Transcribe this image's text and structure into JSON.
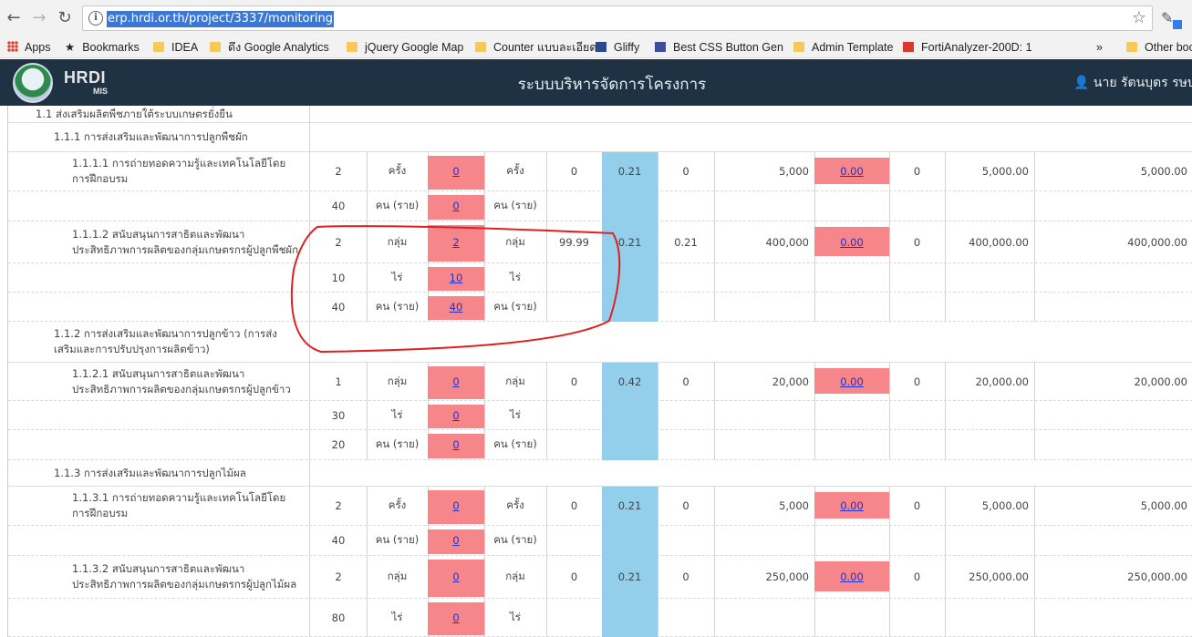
{
  "browser": {
    "url": "erp.hrdi.or.th/project/3337/monitoring",
    "bookmarks": [
      {
        "label": "Apps"
      },
      {
        "label": "Bookmarks"
      },
      {
        "label": "IDEA"
      },
      {
        "label": "ดึง Google Analytics"
      },
      {
        "label": "jQuery Google Map"
      },
      {
        "label": "Counter แบบละเอียด"
      },
      {
        "label": "Gliffy"
      },
      {
        "label": "Best CSS Button Gen"
      },
      {
        "label": "Admin Template"
      },
      {
        "label": "FortiAnalyzer-200D: 1"
      },
      {
        "label": "Other boo"
      }
    ],
    "more_label": "»"
  },
  "app": {
    "brand": "HRDI",
    "brand_sub": "MIS",
    "title": "ระบบบริหารจัดการโครงการ",
    "user": "นาย รัตนบุตร รษบุต"
  },
  "table": {
    "sections": [
      {
        "label": "1.1 ส่งเสริมผลิตพืชภายใต้ระบบเกษตรยั่งยืน"
      },
      {
        "label": "1.1.1 การส่งเสริมและพัฒนาการปลูกพืชผัก"
      },
      {
        "label": "1.1.2 การส่งเสริมและพัฒนาการปลูกข้าว (การส่งเสริมและการปรับปรุงการผลิตข้าว)"
      },
      {
        "label": "1.1.3 การส่งเสริมและพัฒนาการปลูกไม้ผล"
      }
    ],
    "rows": [
      {
        "label": "1.1.1.1 การถ่ายทอดความรู้และเทคโนโลยีโดยการฝึกอบรม",
        "target": "2",
        "unit": "ครั้ง",
        "actual": "0",
        "unit2": "ครั้ง",
        "pct": "0",
        "weight": "0.21",
        "score": "0",
        "budget": "5,000",
        "spent": "0.00",
        "spent_pct": "0",
        "alloc": "5,000.00",
        "total": "5,000.00"
      },
      {
        "label": "",
        "target": "40",
        "unit": "คน (ราย)",
        "actual": "0",
        "unit2": "คน (ราย)"
      },
      {
        "label": "1.1.1.2 สนับสนุนการสาธิตและพัฒนาประสิทธิภาพการผลิตของกลุ่มเกษตรกรผู้ปลูกพืชผัก",
        "target": "2",
        "unit": "กลุ่ม",
        "actual": "2",
        "unit2": "กลุ่ม",
        "pct": "99.99",
        "weight": "0.21",
        "score": "0.21",
        "budget": "400,000",
        "spent": "0.00",
        "spent_pct": "0",
        "alloc": "400,000.00",
        "total": "400,000.00"
      },
      {
        "label": "",
        "target": "10",
        "unit": "ไร่",
        "actual": "10",
        "unit2": "ไร่"
      },
      {
        "label": "",
        "target": "40",
        "unit": "คน (ราย)",
        "actual": "40",
        "unit2": "คน (ราย)"
      },
      {
        "label": "1.1.2.1 สนับสนุนการสาธิตและพัฒนาประสิทธิภาพการผลิตของกลุ่มเกษตรกรผู้ปลูกข้าว",
        "target": "1",
        "unit": "กลุ่ม",
        "actual": "0",
        "unit2": "กลุ่ม",
        "pct": "0",
        "weight": "0.42",
        "score": "0",
        "budget": "20,000",
        "spent": "0.00",
        "spent_pct": "0",
        "alloc": "20,000.00",
        "total": "20,000.00"
      },
      {
        "label": "",
        "target": "30",
        "unit": "ไร่",
        "actual": "0",
        "unit2": "ไร่"
      },
      {
        "label": "",
        "target": "20",
        "unit": "คน (ราย)",
        "actual": "0",
        "unit2": "คน (ราย)"
      },
      {
        "label": "1.1.3.1 การถ่ายทอดความรู้และเทคโนโลยีโดยการฝึกอบรม",
        "target": "2",
        "unit": "ครั้ง",
        "actual": "0",
        "unit2": "ครั้ง",
        "pct": "0",
        "weight": "0.21",
        "score": "0",
        "budget": "5,000",
        "spent": "0.00",
        "spent_pct": "0",
        "alloc": "5,000.00",
        "total": "5,000.00"
      },
      {
        "label": "",
        "target": "40",
        "unit": "คน (ราย)",
        "actual": "0",
        "unit2": "คน (ราย)"
      },
      {
        "label": "1.1.3.2 สนับสนุนการสาธิตและพัฒนาประสิทธิภาพการผลิตของกลุ่มเกษตรกรผู้ปลูกไม้ผล",
        "target": "2",
        "unit": "กลุ่ม",
        "actual": "0",
        "unit2": "กลุ่ม",
        "pct": "0",
        "weight": "0.21",
        "score": "0",
        "budget": "250,000",
        "spent": "0.00",
        "spent_pct": "0",
        "alloc": "250,000.00",
        "total": "250,000.00"
      },
      {
        "label": "",
        "target": "80",
        "unit": "ไร่",
        "actual": "0",
        "unit2": "ไร่"
      }
    ]
  },
  "colors": {
    "header_bg": "#1e3244",
    "highlight_pink": "#f7868a",
    "highlight_blue": "#93cfea",
    "annotation": "#e02020"
  }
}
